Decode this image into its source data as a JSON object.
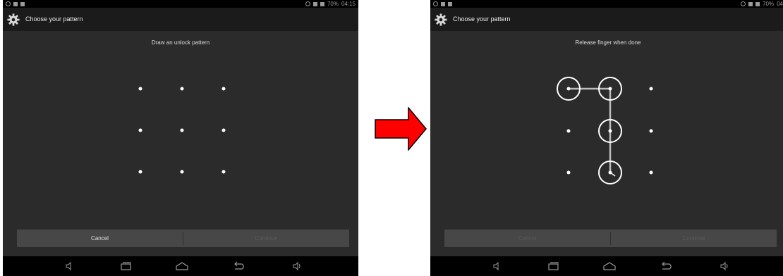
{
  "left_screen": {
    "status_time": "04:15",
    "battery": "70%",
    "title": "Choose your pattern",
    "message": "Draw an unlock pattern",
    "cancel_label": "Cancel",
    "continue_label": "Continue"
  },
  "right_screen": {
    "status_time": "04",
    "battery": "70%",
    "title": "Choose your pattern",
    "message": "Release finger when done",
    "cancel_label": "Cancel",
    "continue_label": "Continue",
    "pattern_selected": [
      0,
      1,
      4,
      7
    ]
  },
  "colors": {
    "arrow": "#ff0000",
    "screen_bg": "#2b2b2b",
    "action_bar": "#1b1b1b"
  }
}
